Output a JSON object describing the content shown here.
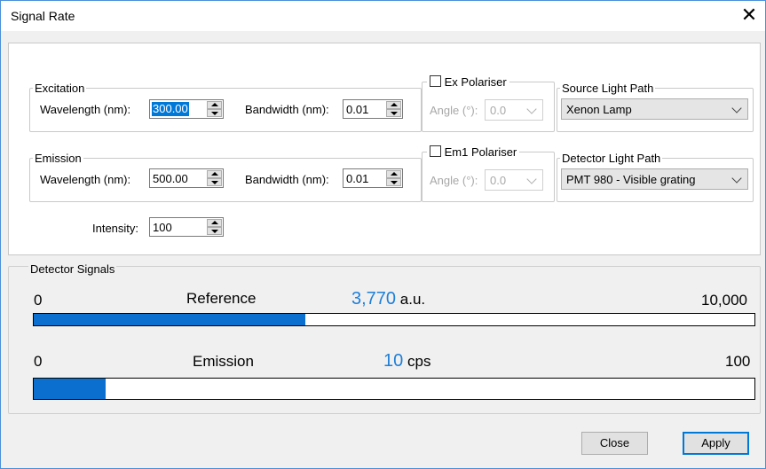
{
  "window": {
    "title": "Signal Rate"
  },
  "excitation": {
    "group_label": "Excitation",
    "wavelength_label": "Wavelength (nm):",
    "wavelength_value": "300.00",
    "bandwidth_label": "Bandwidth (nm):",
    "bandwidth_value": "0.01"
  },
  "emission": {
    "group_label": "Emission",
    "wavelength_label": "Wavelength (nm):",
    "wavelength_value": "500.00",
    "bandwidth_label": "Bandwidth (nm):",
    "bandwidth_value": "0.01"
  },
  "intensity": {
    "label": "Intensity:",
    "value": "100"
  },
  "ex_polariser": {
    "label": "Ex Polariser",
    "checked": false,
    "angle_label": "Angle (°):",
    "angle_value": "0.0"
  },
  "em1_polariser": {
    "label": "Em1 Polariser",
    "checked": false,
    "angle_label": "Angle (°):",
    "angle_value": "0.0"
  },
  "source_light_path": {
    "label": "Source Light Path",
    "selected": "Xenon Lamp"
  },
  "detector_light_path": {
    "label": "Detector Light Path",
    "selected": "PMT 980 - Visible grating"
  },
  "detector_signals": {
    "group_label": "Detector Signals",
    "reference": {
      "min": "0",
      "label": "Reference",
      "value": "3,770",
      "unit": "a.u.",
      "max": "10,000",
      "fraction": 0.377
    },
    "emission": {
      "min": "0",
      "label": "Emission",
      "value": "10",
      "unit": "cps",
      "max": "100",
      "fraction": 0.1
    }
  },
  "buttons": {
    "close": "Close",
    "apply": "Apply"
  },
  "icons": {
    "close": "close-icon"
  },
  "colors": {
    "accent": "#0078d7",
    "bar_fill": "#0a6fcf",
    "value_text": "#1e7fd8"
  }
}
